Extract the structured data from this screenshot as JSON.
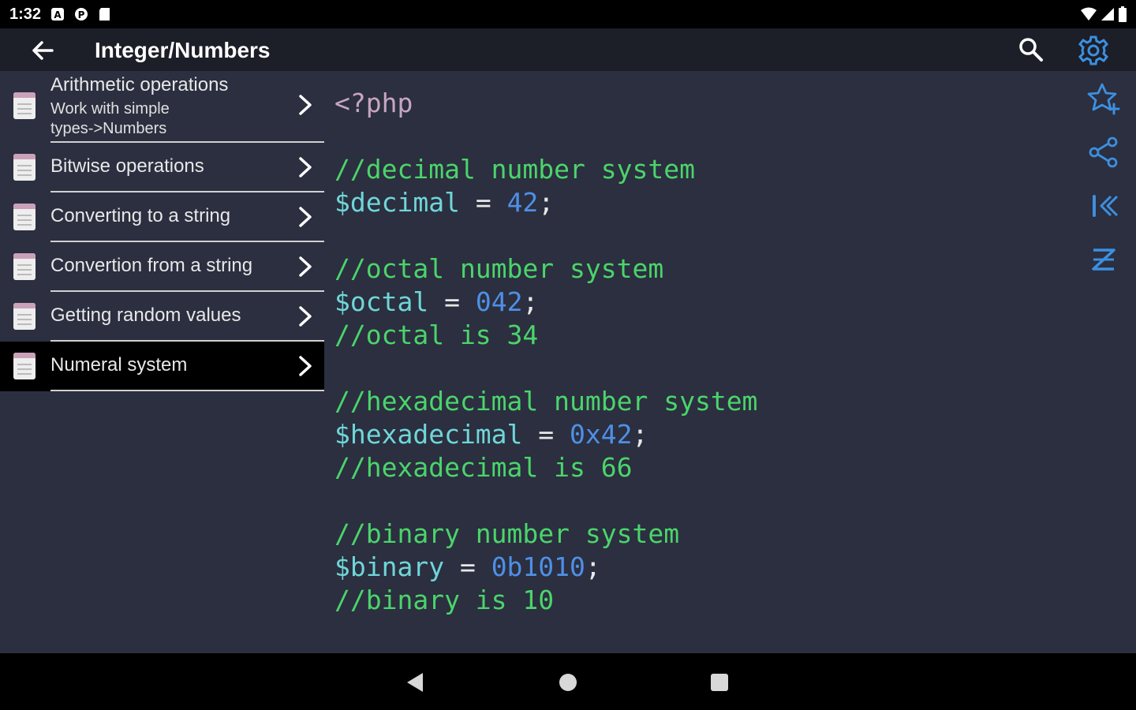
{
  "status": {
    "time": "1:32"
  },
  "appbar": {
    "title": "Integer/Numbers"
  },
  "sidebar": {
    "items": [
      {
        "label": "Arithmetic operations",
        "sub_line1": "Work with simple",
        "sub_line2": "types->Numbers"
      },
      {
        "label": "Bitwise operations"
      },
      {
        "label": "Converting to a string"
      },
      {
        "label": "Convertion from a string"
      },
      {
        "label": "Getting random values"
      },
      {
        "label": "Numeral system",
        "selected": true
      }
    ]
  },
  "code": {
    "open_tag": "<?php",
    "decimal_comment": "//decimal number system",
    "decimal_var": "$decimal",
    "decimal_value": "42",
    "octal_comment": "//octal number system",
    "octal_var": "$octal",
    "octal_value": "042",
    "octal_note": "//octal is 34",
    "hex_comment": "//hexadecimal number system",
    "hex_var": "$hexadecimal",
    "hex_value": "0x42",
    "hex_note": "//hexadecimal is 66",
    "binary_comment": "//binary number system",
    "binary_var": "$binary",
    "binary_value": "0b1010",
    "binary_note": "//binary is 10",
    "assign": " = ",
    "semicolon": ";"
  },
  "colors": {
    "background": "#2b2f3f",
    "comment": "#4bd46b",
    "variable": "#6fd6d8",
    "number": "#4f8fe6",
    "accent": "#3d8fe0"
  },
  "icons": {
    "back": "arrow-left-icon",
    "search": "search-icon",
    "settings": "gear-icon",
    "favorite": "star-add-icon",
    "share": "share-icon",
    "first": "skip-first-icon",
    "sort": "sort-az-icon"
  }
}
